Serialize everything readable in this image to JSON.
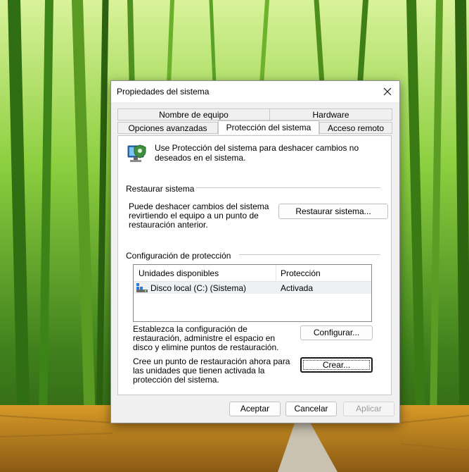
{
  "dialog": {
    "title": "Propiedades del sistema",
    "tabs_row1": [
      "Nombre de equipo",
      "Hardware"
    ],
    "tabs_row2": [
      "Opciones avanzadas",
      "Protección del sistema",
      "Acceso remoto"
    ],
    "intro": "Use Protección del sistema para deshacer cambios no deseados en el sistema.",
    "restore": {
      "group_label": "Restaurar sistema",
      "description": "Puede deshacer cambios del sistema revirtiendo el equipo a un punto de restauración anterior.",
      "button": "Restaurar sistema..."
    },
    "protection": {
      "group_label": "Configuración de protección",
      "columns": [
        "Unidades disponibles",
        "Protección"
      ],
      "rows": [
        {
          "drive": "Disco local (C:) (Sistema)",
          "status": "Activada"
        }
      ],
      "configure_text": "Establezca la configuración de restauración, administre el espacio en disco y elimine puntos de restauración.",
      "configure_button": "Configurar...",
      "create_text": "Cree un punto de restauración ahora para las unidades que tienen activada la protección del sistema.",
      "create_button": "Crear..."
    },
    "footer": {
      "ok": "Aceptar",
      "cancel": "Cancelar",
      "apply": "Aplicar"
    }
  },
  "colors": {
    "selection": "#e5f3ff",
    "row_highlight": "#eef0f2",
    "accent": "#0078d4"
  },
  "icons": [
    "computer-shield-icon",
    "close-icon",
    "drive-icon"
  ]
}
